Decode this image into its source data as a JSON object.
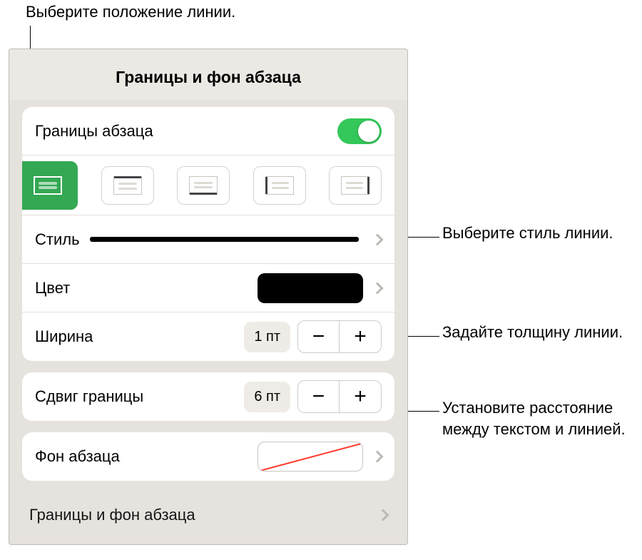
{
  "callouts": {
    "top": "Выберите положение линии.",
    "style": "Выберите стиль линии.",
    "width": "Задайте толщину линии.",
    "offset": "Установите расстояние между текстом и линией."
  },
  "panel": {
    "title": "Границы и фон абзаца",
    "borders_label": "Границы абзаца",
    "style_label": "Стиль",
    "color_label": "Цвет",
    "width_label": "Ширина",
    "width_value": "1 пт",
    "offset_label": "Сдвиг границы",
    "offset_value": "6 пт",
    "fill_label": "Фон абзаца",
    "footer_label": "Границы и фон абзаца"
  },
  "icons": {
    "minus": "−",
    "plus": "+"
  }
}
